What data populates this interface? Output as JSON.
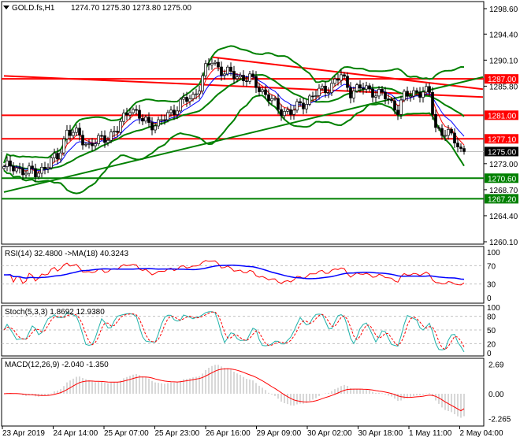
{
  "chart_data": {
    "type": "candlestick",
    "symbol_header": "GOLD.fs,H1",
    "ohlc_header": "1274.70 1275.30 1273.80 1275.00",
    "price_axis_ticks": [
      "1298.60",
      "1294.40",
      "1290.10",
      "1285.80",
      "1273.00",
      "1268.70",
      "1264.40",
      "1260.10"
    ],
    "ylim": [
      1260.1,
      1298.6
    ],
    "levels": [
      {
        "label": "1287.00",
        "value": 1287.0,
        "color": "#ff0000"
      },
      {
        "label": "1281.00",
        "value": 1281.0,
        "color": "#ff0000"
      },
      {
        "label": "1277.10",
        "value": 1277.1,
        "color": "#ff0000"
      },
      {
        "label": "1270.60",
        "value": 1270.6,
        "color": "#008000"
      },
      {
        "label": "1267.20",
        "value": 1267.2,
        "color": "#008000"
      }
    ],
    "current_price": {
      "label": "1275.00",
      "value": 1275.0,
      "color": "#000000"
    },
    "trendlines": [
      {
        "color": "#ff0000",
        "from": [
          0,
          1287.5
        ],
        "to": [
          152,
          1284.0
        ]
      },
      {
        "color": "#ff0000",
        "from": [
          66,
          1290.6
        ],
        "to": [
          152,
          1285.3
        ]
      },
      {
        "color": "#008000",
        "from": [
          0,
          1268.3
        ],
        "to": [
          152,
          1287.3
        ]
      }
    ],
    "close_keyframes": [
      [
        0,
        1272.5
      ],
      [
        6,
        1272
      ],
      [
        10,
        1271.3
      ],
      [
        14,
        1273
      ],
      [
        17,
        1274
      ],
      [
        20,
        1278.5
      ],
      [
        24,
        1277.5
      ],
      [
        27,
        1276
      ],
      [
        31,
        1277
      ],
      [
        36,
        1278.5
      ],
      [
        40,
        1282.5
      ],
      [
        44,
        1280
      ],
      [
        49,
        1279.5
      ],
      [
        52,
        1281
      ],
      [
        56,
        1283
      ],
      [
        60,
        1284
      ],
      [
        62,
        1286
      ],
      [
        64,
        1288.5
      ],
      [
        66,
        1290
      ],
      [
        70,
        1288
      ],
      [
        74,
        1287.5
      ],
      [
        78,
        1287
      ],
      [
        80,
        1286
      ],
      [
        84,
        1284
      ],
      [
        87,
        1282
      ],
      [
        91,
        1281.5
      ],
      [
        95,
        1283
      ],
      [
        99,
        1284.5
      ],
      [
        104,
        1286
      ],
      [
        107,
        1287.5
      ],
      [
        110,
        1285
      ],
      [
        114,
        1285.5
      ],
      [
        117,
        1285
      ],
      [
        121,
        1284
      ],
      [
        125,
        1282
      ],
      [
        127,
        1284
      ],
      [
        131,
        1285
      ],
      [
        135,
        1284.5
      ],
      [
        137,
        1279
      ],
      [
        140,
        1278
      ],
      [
        143,
        1277
      ],
      [
        145,
        1275.5
      ],
      [
        146,
        1275
      ]
    ],
    "x_ticks": [
      "23 Apr 2019",
      "24 Apr 14:00",
      "25 Apr 07:00",
      "25 Apr 23:00",
      "26 Apr 16:00",
      "29 Apr 09:00",
      "30 Apr 02:00",
      "30 Apr 18:00",
      "1 May 11:00",
      "2 May 04:00"
    ],
    "rsi": {
      "label": "RSI(14) 32.4800  ->MA(18) 40.3243",
      "ticks": [
        "100",
        "70",
        "30",
        "0"
      ],
      "value": 32.48,
      "ma": 40.3243
    },
    "stoch": {
      "label": "Stoch(5,3,3) 1.8692 12.9380",
      "ticks": [
        "100",
        "80",
        "50",
        "20",
        "0"
      ],
      "main": 1.8692,
      "signal": 12.938
    },
    "macd": {
      "label": "MACD(12,26,9) -2.040 -1.350",
      "ticks": [
        "2.69",
        "0.00",
        "-2.265"
      ],
      "main": -2.04,
      "signal": -1.35
    }
  }
}
